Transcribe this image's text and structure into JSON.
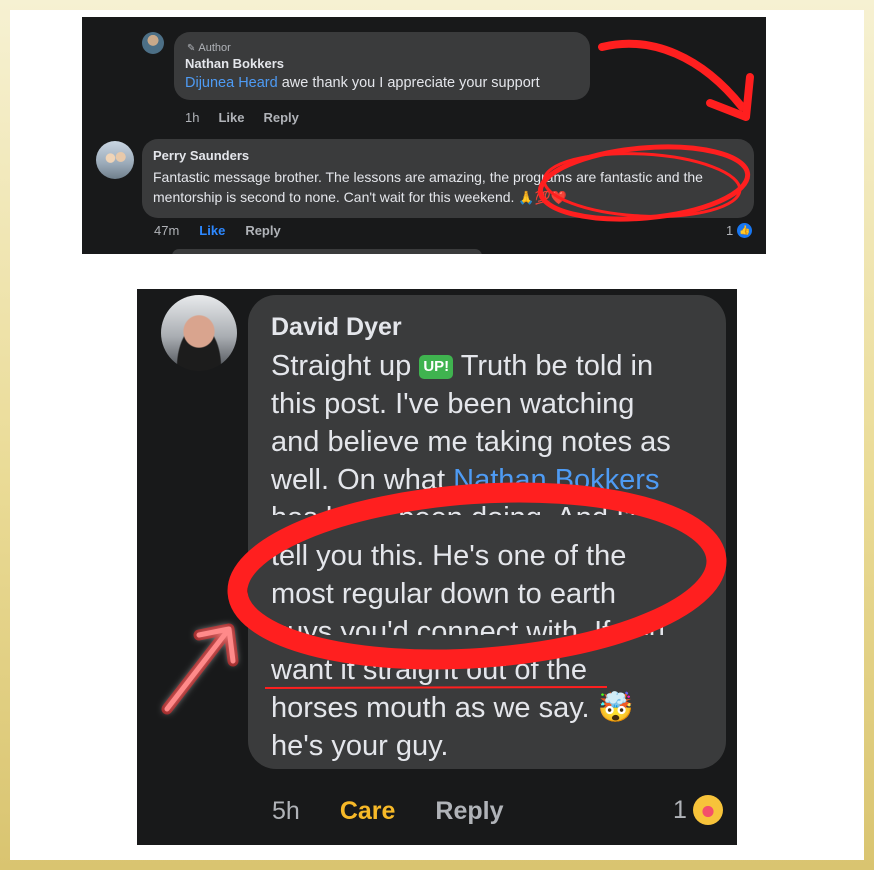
{
  "top_comments": {
    "reply": {
      "author_badge": "Author",
      "name": "Nathan Bokkers",
      "mention": "Dijunea Heard",
      "text": "awe thank you I appreciate your support",
      "time": "1h",
      "like_label": "Like",
      "reply_label": "Reply"
    },
    "comment": {
      "name": "Perry Saunders",
      "text": "Fantastic message brother. The lessons are amazing, the programs are fantastic and the mentorship is second to none. Can't wait for this weekend.",
      "emojis": "🙏💯❤️",
      "time": "47m",
      "like_label": "Like",
      "reply_label": "Reply",
      "reaction_count": "1"
    }
  },
  "zoom_comment": {
    "name": "David Dyer",
    "lines": {
      "l1a": "Straight up",
      "badge": "UP!",
      "l1b": "Truth be told in",
      "l2": "this post. I've been watching",
      "l3": "and believe me taking notes as",
      "l4a": "well. On what",
      "mention": "Nathan Bokkers",
      "l5": "has been been doing.  And I'll",
      "l6": "tell you this.  He's one of the",
      "l7": "most regular down to earth",
      "l8": "guys you'd connect with. If you",
      "l9": "want it straight out of the",
      "l10": "horses mouth as we say.",
      "l10_emoji": "🤯",
      "l11": "he's your guy."
    },
    "time": "5h",
    "care_label": "Care",
    "reply_label": "Reply",
    "reaction_count": "1"
  },
  "colors": {
    "annotation_red": "#ff1f1f",
    "mention_blue": "#4e9bf4",
    "care_yellow": "#f7b928",
    "dark_bg": "#18191a",
    "bubble_bg": "#3a3b3c"
  }
}
